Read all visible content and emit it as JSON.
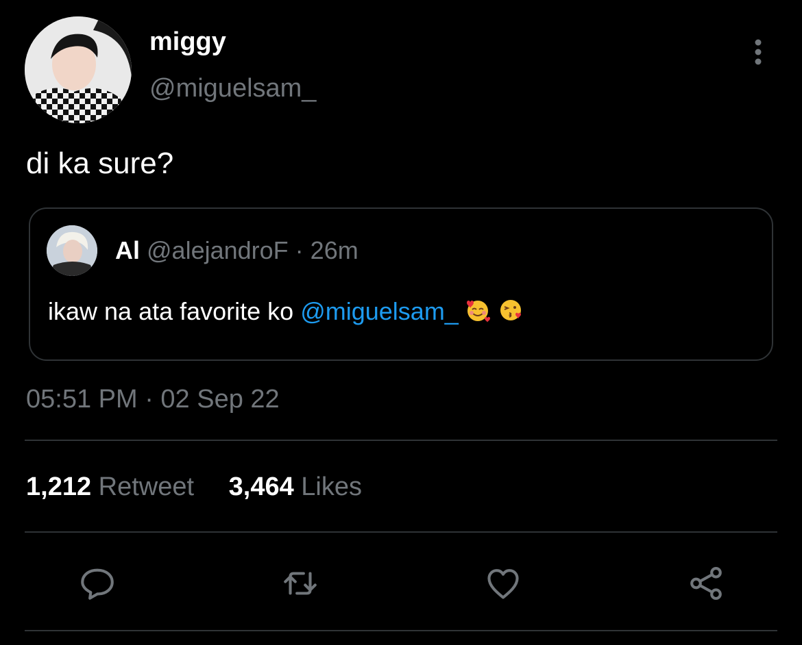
{
  "author": {
    "display_name": "miggy",
    "handle": "@miguelsam_"
  },
  "tweet_text": "di ka sure?",
  "quoted": {
    "name": "Al",
    "handle": "@alejandroF",
    "separator": " · ",
    "time": "26m",
    "text": "ikaw na ata favorite ko ",
    "mention": "@miguelsam_",
    "emoji_1": "smiling-face-with-hearts",
    "emoji_2": "face-blowing-a-kiss"
  },
  "timestamp": "05:51 PM · 02 Sep 22",
  "stats": {
    "retweets_count": "1,212",
    "retweets_label": "Retweet",
    "likes_count": "3,464",
    "likes_label": "Likes"
  },
  "icons": {
    "more": "more-vertical-icon",
    "reply": "reply-icon",
    "retweet": "retweet-icon",
    "like": "heart-icon",
    "share": "share-icon"
  },
  "colors": {
    "background": "#000000",
    "text_primary": "#ffffff",
    "text_secondary": "#71767b",
    "link": "#1d9bf0",
    "border": "#2f3336"
  }
}
